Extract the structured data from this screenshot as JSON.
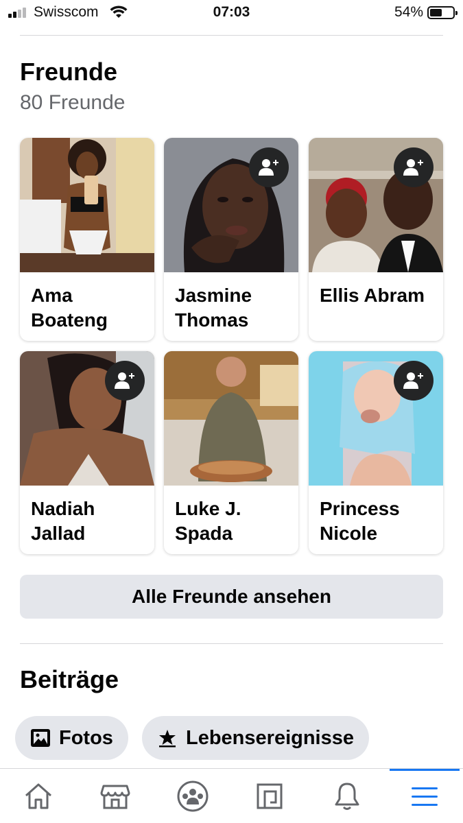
{
  "status": {
    "carrier": "Swisscom",
    "time": "07:03",
    "battery": "54%",
    "battery_level": 0.54
  },
  "friends": {
    "title": "Freunde",
    "count": "80 Freunde",
    "list": [
      {
        "name": "Ama Boateng",
        "show_add": false
      },
      {
        "name": "Jasmine Thomas",
        "show_add": true
      },
      {
        "name": "Ellis Abram",
        "show_add": true
      },
      {
        "name": "Nadiah Jallad",
        "show_add": true
      },
      {
        "name": "Luke J. Spada",
        "show_add": false
      },
      {
        "name": "Princess Nicole",
        "show_add": true
      }
    ],
    "see_all": "Alle Freunde ansehen"
  },
  "posts": {
    "title": "Beiträge",
    "chips": [
      {
        "label": "Fotos",
        "icon": "photos-icon"
      },
      {
        "label": "Lebensereignisse",
        "icon": "star-icon"
      }
    ]
  },
  "tabbar": {
    "active": "menu",
    "items": [
      "home-icon",
      "marketplace-icon",
      "groups-icon",
      "pages-icon",
      "notifications-icon",
      "menu-icon"
    ],
    "accent": "#1877f2"
  }
}
